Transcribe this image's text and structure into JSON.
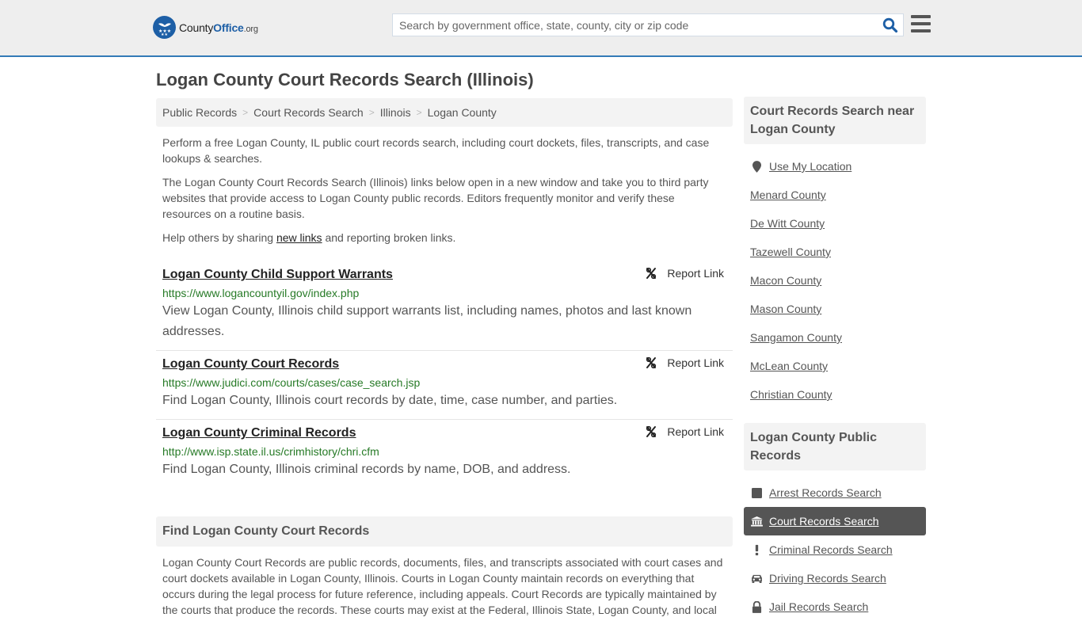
{
  "header": {
    "logo": {
      "brand_first": "County",
      "brand_second": "Office",
      "brand_suffix": ".org"
    },
    "search": {
      "placeholder": "Search by government office, state, county, city or zip code",
      "value": ""
    },
    "colors": {
      "accent": "#337ab7",
      "logo_blue": "#1d5fa6"
    }
  },
  "page": {
    "title": "Logan County Court Records Search (Illinois)"
  },
  "breadcrumb": [
    {
      "label": "Public Records"
    },
    {
      "label": "Court Records Search"
    },
    {
      "label": "Illinois"
    },
    {
      "label": "Logan County"
    }
  ],
  "breadcrumb_separator": ">",
  "intro": {
    "p1": "Perform a free Logan County, IL public court records search, including court dockets, files, transcripts, and case lookups & searches.",
    "p2": "The Logan County Court Records Search (Illinois) links below open in a new window and take you to third party websites that provide access to Logan County public records. Editors frequently monitor and verify these resources on a routine basis.",
    "p3_before": "Help others by sharing ",
    "p3_link": "new links",
    "p3_after": " and reporting broken links."
  },
  "results": [
    {
      "title": "Logan County Child Support Warrants",
      "url": "https://www.logancountyil.gov/index.php",
      "description": "View Logan County, Illinois child support warrants list, including names, photos and last known addresses.",
      "report_label": "Report Link"
    },
    {
      "title": "Logan County Court Records",
      "url": "https://www.judici.com/courts/cases/case_search.jsp",
      "description": "Find Logan County, Illinois court records by date, time, case number, and parties.",
      "report_label": "Report Link"
    },
    {
      "title": "Logan County Criminal Records",
      "url": "http://www.isp.state.il.us/crimhistory/chri.cfm",
      "description": "Find Logan County, Illinois criminal records by name, DOB, and address.",
      "report_label": "Report Link"
    }
  ],
  "find_section": {
    "heading": "Find Logan County Court Records",
    "body": "Logan County Court Records are public records, documents, files, and transcripts associated with court cases and court dockets available in Logan County, Illinois. Courts in Logan County maintain records on everything that occurs during the legal process for future reference, including appeals. Court Records are typically maintained by the courts that produce the records. These courts may exist at the Federal, Illinois State, Logan County, and local"
  },
  "sidebar": {
    "nearby": {
      "heading": "Court Records Search near Logan County",
      "use_location": "Use My Location",
      "items": [
        {
          "label": "Menard County"
        },
        {
          "label": "De Witt County"
        },
        {
          "label": "Tazewell County"
        },
        {
          "label": "Macon County"
        },
        {
          "label": "Mason County"
        },
        {
          "label": "Sangamon County"
        },
        {
          "label": "McLean County"
        },
        {
          "label": "Christian County"
        }
      ]
    },
    "public_records": {
      "heading": "Logan County Public Records",
      "items": [
        {
          "label": "Arrest Records Search",
          "icon": "square-icon",
          "active": false
        },
        {
          "label": "Court Records Search",
          "icon": "courthouse-icon",
          "active": true
        },
        {
          "label": "Criminal Records Search",
          "icon": "exclamation-icon",
          "active": false
        },
        {
          "label": "Driving Records Search",
          "icon": "car-icon",
          "active": false
        },
        {
          "label": "Jail Records Search",
          "icon": "lock-icon",
          "active": false
        }
      ]
    }
  }
}
